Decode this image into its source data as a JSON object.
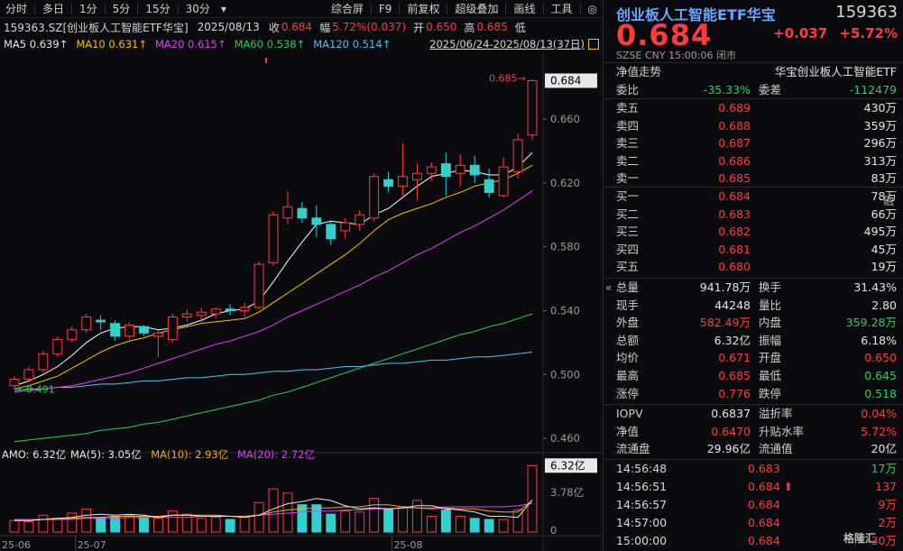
{
  "toolbar": {
    "periods": [
      "分时",
      "多日",
      "1分",
      "5分",
      "15分",
      "30分",
      "▾"
    ],
    "right_items": [
      "综合屏",
      "F9",
      "前复权",
      "超级叠加",
      "画线",
      "工具",
      "◎"
    ]
  },
  "info": {
    "symbol": "159363.SZ[创业板人工智能ETF华宝]",
    "date": "2025/08/13",
    "close_label": "收",
    "close": "0.684",
    "range_label": "幅",
    "range": "5.72%(0.037)",
    "open_label": "开",
    "open": "0.650",
    "high_label": "高",
    "high": "0.685",
    "low_label": "低"
  },
  "ma": {
    "ma5": "MA5 0.639↑",
    "ma10": "MA10 0.631↑",
    "ma20": "MA20 0.615↑",
    "ma60": "MA60 0.538↑",
    "ma120": "MA120 0.514↑",
    "range": "2025/06/24-2025/08/13(37日)"
  },
  "colors": {
    "up": "#ff3b3b",
    "down": "#2fd0d0",
    "ma5": "#ffffff",
    "ma10": "#f5c400",
    "ma20": "#e040fb",
    "ma60": "#2fcc5a",
    "ma120": "#4fc3f7",
    "accent": "#6aa6ff"
  },
  "chart_data": [
    {
      "type": "candlestick",
      "title": "159363.SZ[创业板人工智能ETF华宝]",
      "ylim": [
        0.455,
        0.695
      ],
      "yticks": [
        "0.684",
        "0.660",
        "0.620",
        "0.580",
        "0.540",
        "0.500",
        "0.460"
      ],
      "xlabels": [
        "25-06",
        "25-07",
        "25-08"
      ],
      "annotations": [
        "0.685→",
        "←0.491"
      ],
      "candles": [
        {
          "o": 0.493,
          "h": 0.499,
          "l": 0.491,
          "c": 0.497
        },
        {
          "o": 0.497,
          "h": 0.505,
          "l": 0.495,
          "c": 0.503
        },
        {
          "o": 0.503,
          "h": 0.515,
          "l": 0.501,
          "c": 0.513
        },
        {
          "o": 0.513,
          "h": 0.524,
          "l": 0.511,
          "c": 0.522
        },
        {
          "o": 0.522,
          "h": 0.53,
          "l": 0.52,
          "c": 0.528
        },
        {
          "o": 0.528,
          "h": 0.538,
          "l": 0.526,
          "c": 0.536
        },
        {
          "o": 0.534,
          "h": 0.537,
          "l": 0.528,
          "c": 0.533
        },
        {
          "o": 0.532,
          "h": 0.534,
          "l": 0.521,
          "c": 0.524
        },
        {
          "o": 0.524,
          "h": 0.533,
          "l": 0.522,
          "c": 0.531
        },
        {
          "o": 0.53,
          "h": 0.531,
          "l": 0.524,
          "c": 0.526
        },
        {
          "o": 0.524,
          "h": 0.528,
          "l": 0.511,
          "c": 0.526
        },
        {
          "o": 0.522,
          "h": 0.538,
          "l": 0.52,
          "c": 0.536
        },
        {
          "o": 0.536,
          "h": 0.541,
          "l": 0.533,
          "c": 0.538
        },
        {
          "o": 0.537,
          "h": 0.542,
          "l": 0.533,
          "c": 0.539
        },
        {
          "o": 0.538,
          "h": 0.542,
          "l": 0.535,
          "c": 0.541
        },
        {
          "o": 0.541,
          "h": 0.544,
          "l": 0.537,
          "c": 0.54
        },
        {
          "o": 0.54,
          "h": 0.545,
          "l": 0.536,
          "c": 0.542
        },
        {
          "o": 0.542,
          "h": 0.571,
          "l": 0.541,
          "c": 0.569
        },
        {
          "o": 0.57,
          "h": 0.602,
          "l": 0.568,
          "c": 0.6
        },
        {
          "o": 0.598,
          "h": 0.615,
          "l": 0.594,
          "c": 0.605
        },
        {
          "o": 0.604,
          "h": 0.608,
          "l": 0.595,
          "c": 0.598
        },
        {
          "o": 0.598,
          "h": 0.606,
          "l": 0.586,
          "c": 0.594
        },
        {
          "o": 0.594,
          "h": 0.596,
          "l": 0.581,
          "c": 0.585
        },
        {
          "o": 0.59,
          "h": 0.598,
          "l": 0.585,
          "c": 0.595
        },
        {
          "o": 0.594,
          "h": 0.603,
          "l": 0.59,
          "c": 0.6
        },
        {
          "o": 0.598,
          "h": 0.626,
          "l": 0.596,
          "c": 0.624
        },
        {
          "o": 0.622,
          "h": 0.627,
          "l": 0.614,
          "c": 0.618
        },
        {
          "o": 0.618,
          "h": 0.645,
          "l": 0.612,
          "c": 0.624
        },
        {
          "o": 0.622,
          "h": 0.632,
          "l": 0.609,
          "c": 0.626
        },
        {
          "o": 0.626,
          "h": 0.633,
          "l": 0.621,
          "c": 0.63
        },
        {
          "o": 0.632,
          "h": 0.639,
          "l": 0.612,
          "c": 0.624
        },
        {
          "o": 0.626,
          "h": 0.638,
          "l": 0.618,
          "c": 0.631
        },
        {
          "o": 0.631,
          "h": 0.637,
          "l": 0.62,
          "c": 0.625
        },
        {
          "o": 0.622,
          "h": 0.629,
          "l": 0.611,
          "c": 0.614
        },
        {
          "o": 0.612,
          "h": 0.636,
          "l": 0.611,
          "c": 0.63
        },
        {
          "o": 0.627,
          "h": 0.651,
          "l": 0.623,
          "c": 0.647
        },
        {
          "o": 0.65,
          "h": 0.685,
          "l": 0.647,
          "c": 0.684
        }
      ],
      "ma5": [
        0.493,
        0.496,
        0.5,
        0.505,
        0.512,
        0.52,
        0.526,
        0.529,
        0.53,
        0.53,
        0.528,
        0.529,
        0.531,
        0.534,
        0.538,
        0.54,
        0.541,
        0.546,
        0.558,
        0.571,
        0.583,
        0.594,
        0.596,
        0.595,
        0.594,
        0.6,
        0.604,
        0.611,
        0.618,
        0.624,
        0.626,
        0.628,
        0.627,
        0.625,
        0.625,
        0.63,
        0.639
      ],
      "ma10": [
        0.491,
        0.493,
        0.496,
        0.499,
        0.504,
        0.509,
        0.514,
        0.518,
        0.521,
        0.523,
        0.526,
        0.528,
        0.53,
        0.532,
        0.533,
        0.534,
        0.535,
        0.539,
        0.545,
        0.551,
        0.557,
        0.563,
        0.569,
        0.575,
        0.582,
        0.59,
        0.597,
        0.601,
        0.604,
        0.607,
        0.611,
        0.614,
        0.618,
        0.62,
        0.622,
        0.626,
        0.631
      ],
      "ma20": [
        0.489,
        0.49,
        0.491,
        0.492,
        0.493,
        0.495,
        0.497,
        0.499,
        0.501,
        0.504,
        0.507,
        0.51,
        0.513,
        0.516,
        0.519,
        0.521,
        0.524,
        0.527,
        0.531,
        0.536,
        0.54,
        0.544,
        0.548,
        0.552,
        0.556,
        0.561,
        0.565,
        0.57,
        0.575,
        0.579,
        0.584,
        0.589,
        0.593,
        0.598,
        0.603,
        0.609,
        0.615
      ],
      "ma60": [
        0.458,
        0.459,
        0.46,
        0.461,
        0.462,
        0.463,
        0.465,
        0.466,
        0.467,
        0.469,
        0.47,
        0.472,
        0.474,
        0.476,
        0.478,
        0.48,
        0.482,
        0.484,
        0.487,
        0.489,
        0.492,
        0.495,
        0.498,
        0.501,
        0.504,
        0.507,
        0.51,
        0.513,
        0.516,
        0.519,
        0.522,
        0.525,
        0.527,
        0.53,
        0.532,
        0.535,
        0.538
      ],
      "ma120": [
        0.49,
        0.491,
        0.491,
        0.492,
        0.492,
        0.493,
        0.494,
        0.494,
        0.495,
        0.496,
        0.496,
        0.497,
        0.498,
        0.498,
        0.499,
        0.5,
        0.5,
        0.501,
        0.502,
        0.502,
        0.503,
        0.503,
        0.504,
        0.505,
        0.505,
        0.506,
        0.507,
        0.507,
        0.508,
        0.509,
        0.509,
        0.51,
        0.511,
        0.511,
        0.512,
        0.513,
        0.514
      ]
    },
    {
      "type": "bar",
      "title": "AMO",
      "legend": [
        "AMO: 6.32亿",
        "MA(5): 3.05亿",
        "MA(10): 2.93亿",
        "MA(20): 2.72亿"
      ],
      "unit": "亿",
      "ylim": [
        0,
        6.6
      ],
      "yticks": [
        "6.32亿",
        "3.78亿",
        "0"
      ],
      "values": [
        1.1,
        1.0,
        1.6,
        1.3,
        1.8,
        2.2,
        1.4,
        1.5,
        1.6,
        1.4,
        1.3,
        2.0,
        1.7,
        1.3,
        1.4,
        1.2,
        1.5,
        2.8,
        4.1,
        3.7,
        2.6,
        2.6,
        1.7,
        2.0,
        1.9,
        3.2,
        2.2,
        2.4,
        3.0,
        1.5,
        2.1,
        1.5,
        1.3,
        1.2,
        1.2,
        2.1,
        6.32
      ],
      "ma5": [
        1.1,
        1.1,
        1.2,
        1.3,
        1.4,
        1.6,
        1.7,
        1.6,
        1.7,
        1.6,
        1.4,
        1.6,
        1.6,
        1.5,
        1.5,
        1.5,
        1.4,
        1.6,
        2.2,
        2.7,
        2.9,
        3.2,
        3.0,
        2.5,
        2.2,
        2.3,
        2.2,
        2.3,
        2.5,
        2.5,
        2.2,
        2.1,
        1.9,
        1.5,
        1.5,
        1.4,
        3.05
      ],
      "ma10": [
        1.1,
        1.1,
        1.2,
        1.2,
        1.3,
        1.4,
        1.4,
        1.5,
        1.5,
        1.5,
        1.5,
        1.6,
        1.6,
        1.6,
        1.6,
        1.5,
        1.5,
        1.6,
        1.9,
        2.1,
        2.2,
        2.3,
        2.3,
        2.4,
        2.4,
        2.6,
        2.6,
        2.4,
        2.3,
        2.2,
        2.3,
        2.2,
        2.2,
        2.0,
        1.9,
        1.9,
        3.0
      ],
      "ma20": [
        1.2,
        1.2,
        1.2,
        1.2,
        1.2,
        1.3,
        1.3,
        1.3,
        1.4,
        1.4,
        1.4,
        1.4,
        1.4,
        1.5,
        1.5,
        1.5,
        1.5,
        1.6,
        1.7,
        1.8,
        1.9,
        2.0,
        2.0,
        2.1,
        2.1,
        2.2,
        2.2,
        2.3,
        2.3,
        2.3,
        2.4,
        2.4,
        2.4,
        2.4,
        2.4,
        2.5,
        2.72
      ]
    }
  ],
  "quote": {
    "name": "创业板人工智能ETF华宝",
    "code": "159363",
    "price": "0.684",
    "change": "+0.037",
    "change_pct": "+5.72%",
    "sub": "SZSE  CNY  15:00:06  闭市",
    "nav_trend_label": "净值走势",
    "nav_name": "华宝创业板人工智能ETF",
    "weibi_label": "委比",
    "weibi": "-35.33%",
    "weicha_label": "委差",
    "weicha": "-112479",
    "asks": [
      {
        "label": "卖五",
        "price": "0.689",
        "vol": "430万"
      },
      {
        "label": "卖四",
        "price": "0.688",
        "vol": "359万"
      },
      {
        "label": "卖三",
        "price": "0.687",
        "vol": "296万"
      },
      {
        "label": "卖二",
        "price": "0.686",
        "vol": "313万"
      },
      {
        "label": "卖一",
        "price": "0.685",
        "vol": "83万"
      }
    ],
    "rong": "融",
    "bids": [
      {
        "label": "买一",
        "price": "0.684",
        "vol": "78万"
      },
      {
        "label": "买二",
        "price": "0.683",
        "vol": "66万"
      },
      {
        "label": "买三",
        "price": "0.682",
        "vol": "495万"
      },
      {
        "label": "买四",
        "price": "0.681",
        "vol": "45万"
      },
      {
        "label": "买五",
        "price": "0.680",
        "vol": "19万"
      }
    ],
    "stats": [
      {
        "l1": "总量",
        "v1": "941.78万",
        "c1": "white",
        "l2": "换手",
        "v2": "31.43%",
        "c2": "white"
      },
      {
        "l1": "现手",
        "v1": "44248",
        "c1": "white",
        "l2": "量比",
        "v2": "2.80",
        "c2": "white"
      },
      {
        "l1": "外盘",
        "v1": "582.49万",
        "c1": "red",
        "l2": "内盘",
        "v2": "359.28万",
        "c2": "green"
      },
      {
        "l1": "总额",
        "v1": "6.32亿",
        "c1": "white",
        "l2": "振幅",
        "v2": "6.18%",
        "c2": "white"
      },
      {
        "l1": "均价",
        "v1": "0.671",
        "c1": "red",
        "l2": "开盘",
        "v2": "0.650",
        "c2": "red"
      },
      {
        "l1": "最高",
        "v1": "0.685",
        "c1": "red",
        "l2": "最低",
        "v2": "0.645",
        "c2": "green"
      },
      {
        "l1": "涨停",
        "v1": "0.776",
        "c1": "red",
        "l2": "跌停",
        "v2": "0.518",
        "c2": "green"
      }
    ],
    "stats2": [
      {
        "l1": "IOPV",
        "v1": "0.6837",
        "c1": "white",
        "l2": "溢折率",
        "v2": "0.04%",
        "c2": "red"
      },
      {
        "l1": "净值",
        "v1": "0.6470",
        "c1": "red",
        "l2": "升贴水率",
        "v2": "5.72%",
        "c2": "red"
      },
      {
        "l1": "流通盘",
        "v1": "29.96亿",
        "c1": "white",
        "l2": "流通值",
        "v2": "20亿",
        "c2": "white"
      }
    ],
    "ticks": [
      {
        "t": "14:56:48",
        "p": "0.683",
        "v": "17万",
        "vc": "green"
      },
      {
        "t": "14:56:51",
        "p": "0.684 ⬆",
        "v": "137",
        "vc": "red"
      },
      {
        "t": "14:56:57",
        "p": "0.684",
        "v": "9万",
        "vc": "red"
      },
      {
        "t": "14:57:00",
        "p": "0.684",
        "v": "2万",
        "vc": "red"
      },
      {
        "t": "15:00:00",
        "p": "0.684",
        "v": "30万",
        "vc": "red"
      }
    ],
    "watermark": "格隆汇"
  }
}
